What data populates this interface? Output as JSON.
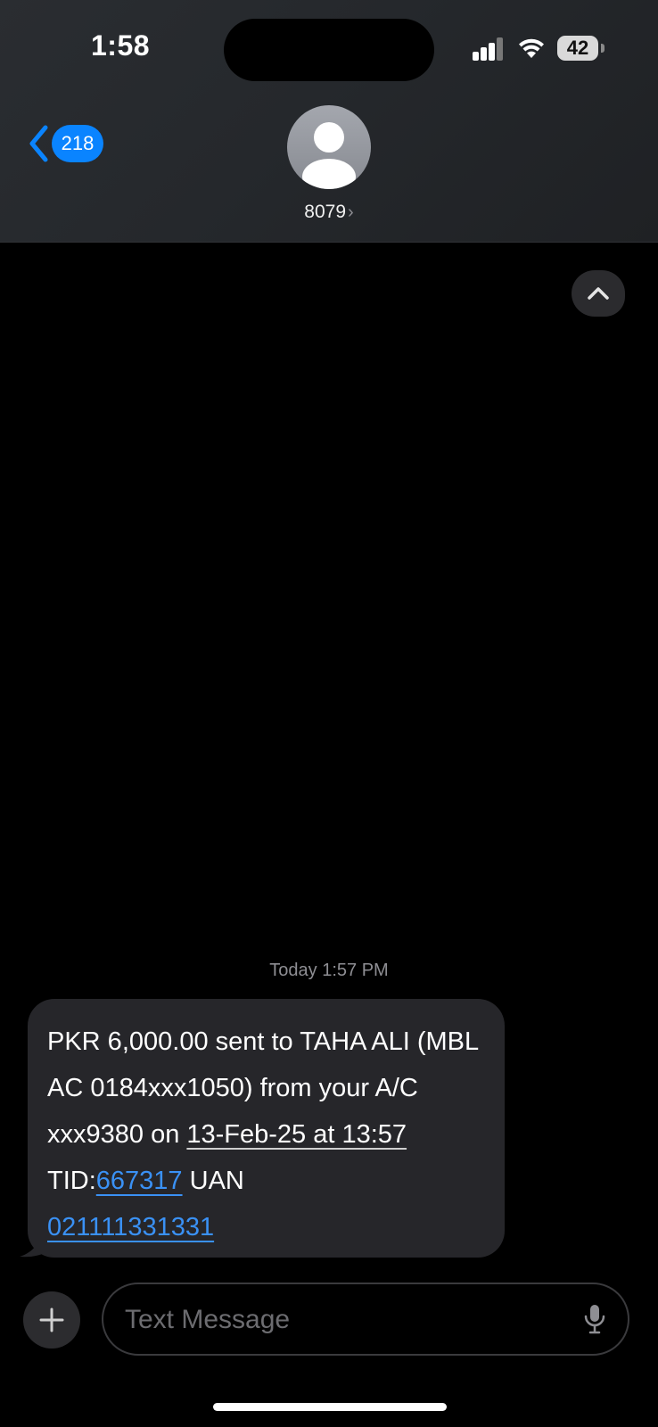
{
  "status_bar": {
    "time": "1:58",
    "battery": "42"
  },
  "header": {
    "back_count": "218",
    "contact_name": "8079",
    "contact_chevron": "›"
  },
  "conversation": {
    "timestamp": "Today 1:57 PM",
    "messages": [
      {
        "direction": "incoming",
        "text_plain_1": "PKR 6,000.00 sent to TAHA ALI (MBL AC 0184xxx1050) from your A/C xxx9380 on ",
        "date_link": "13-Feb-25 at 13:57",
        "text_plain_2": " TID:",
        "tid_link": "667317",
        "text_plain_3": " UAN ",
        "uan_link": "021111331331"
      }
    ]
  },
  "compose": {
    "placeholder": "Text Message",
    "value": ""
  },
  "icons": {
    "back": "chevron-left-icon",
    "avatar": "person-silhouette-icon",
    "scroll_up": "chevron-up-icon",
    "add": "plus-icon",
    "mic": "microphone-icon",
    "signal": "cellular-signal-icon",
    "wifi": "wifi-icon",
    "battery": "battery-icon"
  },
  "colors": {
    "accent": "#0a84ff",
    "link": "#3a91f5",
    "bubble": "#26262a",
    "background": "#000000"
  }
}
